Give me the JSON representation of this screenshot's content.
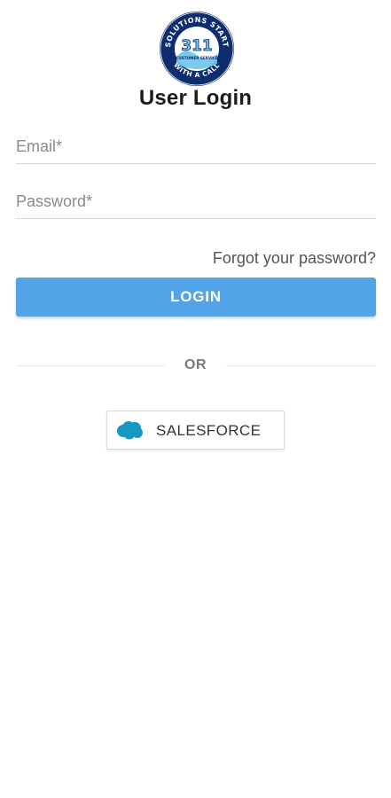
{
  "logo": {
    "top_text": "SOLUTIONS START",
    "center_text": "311",
    "sub_text": "CUSTOMER SERVICE",
    "bottom_text": "WITH A CALL",
    "ring_color": "#0d2d6e",
    "accent_color": "#6fc3ea"
  },
  "header": {
    "title": "User Login"
  },
  "form": {
    "email_placeholder": "Email*",
    "password_placeholder": "Password*",
    "forgot_label": "Forgot your password?",
    "login_label": "LOGIN"
  },
  "divider": {
    "label": "OR"
  },
  "sso": {
    "salesforce_label": "SALESFORCE",
    "icon": "salesforce-cloud-icon",
    "icon_color": "#1798c1"
  },
  "colors": {
    "primary": "#52a4e6",
    "text": "#212121",
    "muted": "#8a8a8a"
  }
}
